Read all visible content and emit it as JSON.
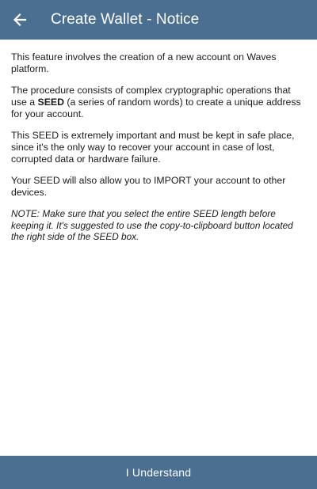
{
  "app_bar": {
    "title": "Create Wallet - Notice",
    "back_icon": "arrow-left-icon",
    "background": "#4a6f91"
  },
  "content": {
    "p1": "This feature involves the creation of a new account on Waves platform.",
    "p2_before": "The procedure consists of complex cryptographic operations that use a ",
    "p2_bold": "SEED",
    "p2_after": " (a series of random words) to create a unique address for your account.",
    "p3": "This SEED is extremely important and must be kept in safe place, since it's the only way to recover your account in case of lost, corrupted data or hardware failure.",
    "p4": "Your SEED will also allow you to IMPORT your account to other devices.",
    "note": "NOTE: Make sure that you select the entire SEED length before keeping it. It's suggested to use the copy-to-clipboard button located the right side of the SEED box."
  },
  "footer": {
    "button_label": "I Understand",
    "background": "#4a6f91"
  }
}
